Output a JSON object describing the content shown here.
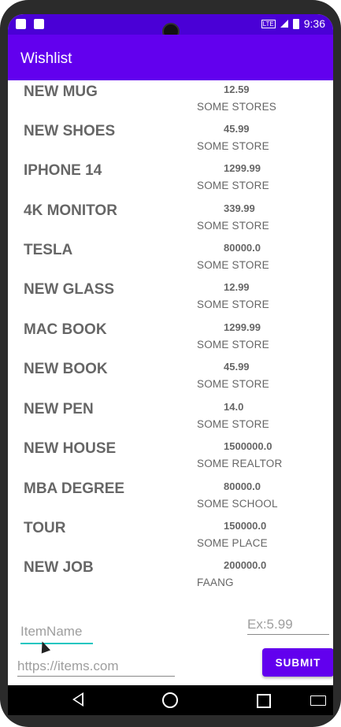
{
  "status_bar": {
    "time": "9:36",
    "network": "LTE"
  },
  "app_bar": {
    "title": "Wishlist"
  },
  "items": [
    {
      "name": "NEW MUG",
      "price": "12.59",
      "store": "SOME STORES"
    },
    {
      "name": "NEW SHOES",
      "price": "45.99",
      "store": "SOME STORE"
    },
    {
      "name": "IPHONE 14",
      "price": "1299.99",
      "store": "SOME STORE"
    },
    {
      "name": "4K MONITOR",
      "price": "339.99",
      "store": "SOME STORE"
    },
    {
      "name": "TESLA",
      "price": "80000.0",
      "store": "SOME STORE"
    },
    {
      "name": "NEW GLASS",
      "price": "12.99",
      "store": "SOME STORE"
    },
    {
      "name": "MAC BOOK",
      "price": "1299.99",
      "store": "SOME STORE"
    },
    {
      "name": "NEW BOOK",
      "price": "45.99",
      "store": "SOME STORE"
    },
    {
      "name": "NEW PEN",
      "price": "14.0",
      "store": "SOME STORE"
    },
    {
      "name": "NEW HOUSE",
      "price": "1500000.0",
      "store": "SOME REALTOR"
    },
    {
      "name": "MBA DEGREE",
      "price": "80000.0",
      "store": "SOME SCHOOL"
    },
    {
      "name": "TOUR",
      "price": "150000.0",
      "store": "SOME PLACE"
    },
    {
      "name": "NEW JOB",
      "price": "200000.0",
      "store": "FAANG"
    }
  ],
  "form": {
    "item_name_placeholder": "ItemName",
    "price_placeholder": "Ex:5.99",
    "url_placeholder": "https://items.com",
    "submit_label": "SUBMIT"
  },
  "colors": {
    "primary": "#6200ee",
    "status_bar": "#4a00d6",
    "accent": "#1ec6c0"
  }
}
